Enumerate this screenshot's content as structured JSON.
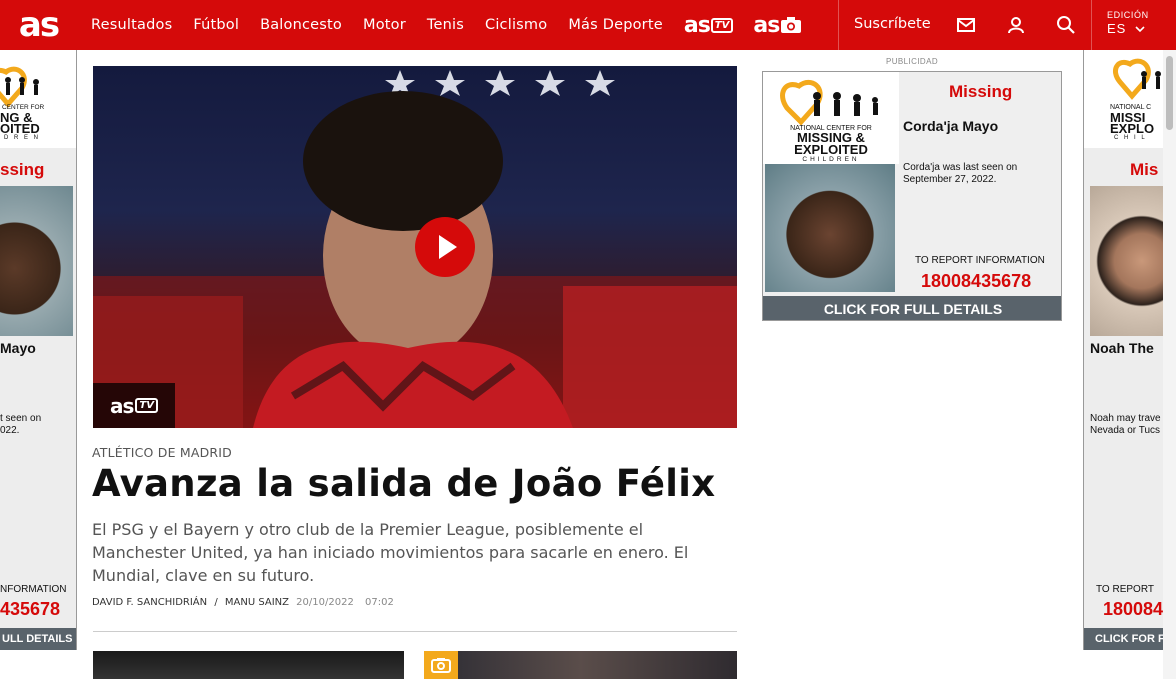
{
  "header": {
    "logo": "as",
    "nav": [
      "Resultados",
      "Fútbol",
      "Baloncesto",
      "Motor",
      "Tenis",
      "Ciclismo",
      "Más Deporte"
    ],
    "brand_tv": "as",
    "brand_tv_tag": "TV",
    "brand_photo": "as",
    "subscribe": "Suscríbete",
    "edition_label": "EDICIÓN",
    "edition_value": "ES"
  },
  "hero": {
    "badge_text": "as",
    "badge_tag": "TV",
    "kicker": "ATLÉTICO DE MADRID",
    "headline": "Avanza la salida de João Félix",
    "summary": "El PSG y el Bayern y otro club de la Premier League, posiblemente el Manchester United, ya han iniciado movimientos para sacarle en enero. El Mundial, clave en su futuro.",
    "author1": "DAVID F. SANCHIDRIÁN",
    "separator": "/",
    "author2": "MANU SAINZ",
    "date": "20/10/2022",
    "time": "07:02"
  },
  "ad": {
    "label": "PUBLICIDAD",
    "org_line1": "NATIONAL CENTER FOR",
    "org_line2": "MISSING &",
    "org_line3": "EXPLOITED",
    "org_line4": "CHILDREN",
    "missing": "Missing",
    "name": "Corda'ja  Mayo",
    "seen": "Corda'ja was last seen on September 27, 2022.",
    "report": "TO REPORT INFORMATION",
    "phone": "18008435678",
    "cta": "CLICK FOR FULL DETAILS"
  },
  "side_left": {
    "org_line1": "CENTER FOR",
    "org_line2": "NG &",
    "org_line3": "OITED",
    "org_line4": "D R E N",
    "missing": "ssing",
    "name": "Mayo",
    "seen_line1": "t seen on",
    "seen_line2": "022.",
    "report": "NFORMATION",
    "phone": "435678",
    "cta": "ULL DETAILS"
  },
  "side_right": {
    "org_line1": "NATIONAL C",
    "org_line2": "MISSI",
    "org_line3": "EXPLO",
    "org_line4": "C H I L",
    "missing": "Mis",
    "name": "Noah  The",
    "seen_line1": "Noah may trave",
    "seen_line2": "Nevada or Tucs",
    "report": "TO REPORT",
    "phone": "180084",
    "cta": "CLICK FOR F"
  },
  "colors": {
    "brand_red": "#d50a0a",
    "ad_cta": "#59636b",
    "photo_badge": "#f3a91c"
  }
}
